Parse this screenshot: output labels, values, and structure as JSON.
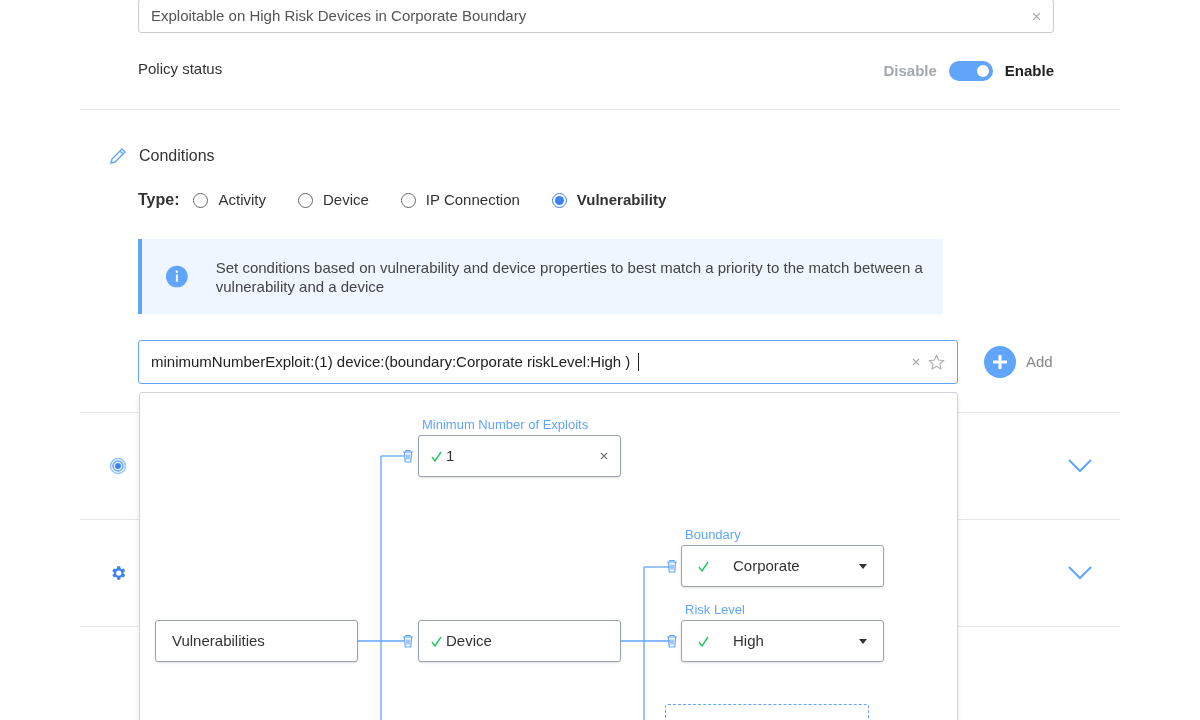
{
  "policy_name_field": {
    "value": "Exploitable on High Risk Devices in Corporate Boundary"
  },
  "policy_status": {
    "label": "Policy status",
    "off_label": "Disable",
    "on_label": "Enable",
    "on": true
  },
  "conditions": {
    "title": "Conditions",
    "type_label": "Type:",
    "types": [
      {
        "label": "Activity",
        "selected": false
      },
      {
        "label": "Device",
        "selected": false
      },
      {
        "label": "IP Connection",
        "selected": false
      },
      {
        "label": "Vulnerability",
        "selected": true
      }
    ],
    "info": "Set conditions based on vulnerability and device properties to best match a priority to the match between a vulnerability and a device",
    "query": "minimumNumberExploit:(1) device:(boundary:Corporate riskLevel:High )",
    "add_button": "Add"
  },
  "collapsed_sections": [
    {
      "kind": "radar",
      "expanded": false
    },
    {
      "kind": "gear",
      "expanded": false
    }
  ],
  "query_tree": {
    "root": "Vulnerabilities",
    "children": [
      {
        "kind": "input",
        "label": "Minimum Number of Exploits",
        "value": "1",
        "valid": true
      },
      {
        "kind": "group",
        "value": "Device",
        "valid": true,
        "children": [
          {
            "kind": "select",
            "label": "Boundary",
            "value": "Corporate",
            "valid": true
          },
          {
            "kind": "select",
            "label": "Risk Level",
            "value": "High",
            "valid": true
          },
          {
            "kind": "add"
          }
        ]
      }
    ]
  }
}
